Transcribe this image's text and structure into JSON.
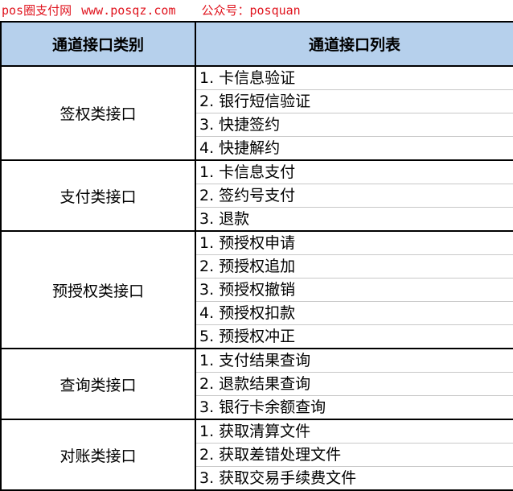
{
  "watermark": {
    "site": "pos圈支付网",
    "url": "www.posqz.com",
    "public_account": "公众号：posquan",
    "color": "#e0141e"
  },
  "header_color": "#b6d0ec",
  "table": {
    "headers": [
      "通道接口类别",
      "通道接口列表"
    ],
    "groups": [
      {
        "category": "签权类接口",
        "items": [
          "1. 卡信息验证",
          "2. 银行短信验证",
          "3. 快捷签约",
          "4. 快捷解约"
        ]
      },
      {
        "category": "支付类接口",
        "items": [
          "1. 卡信息支付",
          "2. 签约号支付",
          "3. 退款"
        ]
      },
      {
        "category": "预授权类接口",
        "items": [
          "1. 预授权申请",
          "2. 预授权追加",
          "3. 预授权撤销",
          "4. 预授权扣款",
          "5. 预授权冲正"
        ]
      },
      {
        "category": "查询类接口",
        "items": [
          "1. 支付结果查询",
          "2. 退款结果查询",
          "3. 银行卡余额查询"
        ]
      },
      {
        "category": "对账类接口",
        "items": [
          "1. 获取清算文件",
          "2. 获取差错处理文件",
          "3. 获取交易手续费文件"
        ]
      }
    ]
  }
}
